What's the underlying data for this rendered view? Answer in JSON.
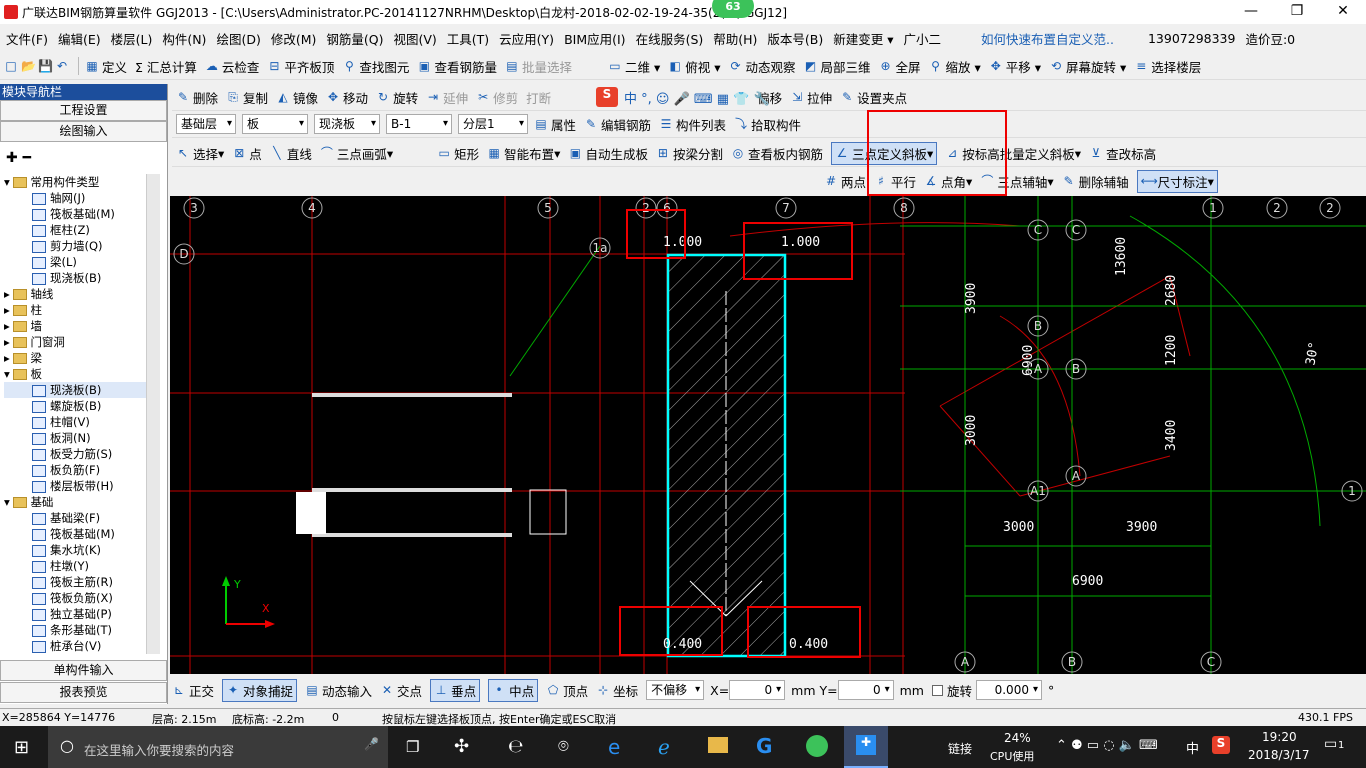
{
  "titlebar": {
    "title": "广联达BIM钢筋算量软件 GGJ2013 - [C:\\Users\\Administrator.PC-20141127NRHM\\Desktop\\白龙村-2018-02-02-19-24-35(2(...).GGJ12]",
    "badge": "63"
  },
  "menu": [
    "文件(F)",
    "编辑(E)",
    "楼层(L)",
    "构件(N)",
    "绘图(D)",
    "修改(M)",
    "钢筋量(Q)",
    "视图(V)",
    "工具(T)",
    "云应用(Y)",
    "BIM应用(I)",
    "在线服务(S)",
    "帮助(H)",
    "版本号(B)",
    "新建变更 ▾",
    "广小二",
    "如何快速布置自定义范..",
    "13907298339",
    "造价豆:0"
  ],
  "toolbar1": [
    "定义",
    "Σ 汇总计算",
    "云检查",
    "平齐板顶",
    "查找图元",
    "查看钢筋量",
    "批量选择",
    "二维 ▾",
    "俯视 ▾",
    "动态观察",
    "局部三维",
    "全屏",
    "缩放 ▾",
    "平移 ▾",
    "屏幕旋转 ▾",
    "选择楼层"
  ],
  "toolbar2": [
    "删除",
    "复制",
    "镜像",
    "移动",
    "旋转",
    "延伸",
    "修剪",
    "打断",
    "偏移",
    "拉伸",
    "设置夹点"
  ],
  "selectors": {
    "floor": "基础层",
    "category": "板",
    "type": "现浇板",
    "name": "B-1",
    "layer": "分层1"
  },
  "toolbar3": [
    "属性",
    "编辑钢筋",
    "构件列表",
    "拾取构件"
  ],
  "toolbar4": [
    "选择",
    "点",
    "直线",
    "三点画弧",
    "矩形",
    "智能布置",
    "自动生成板",
    "按梁分割",
    "查看板内钢筋",
    "三点定义斜板",
    "按标高批量定义斜板",
    "查改标高"
  ],
  "toolbar5": [
    "两点",
    "平行",
    "点角",
    "三点辅轴",
    "删除辅轴",
    "尺寸标注"
  ],
  "sidebar": {
    "title": "模块导航栏",
    "buttons": [
      "工程设置",
      "绘图输入"
    ],
    "tree": [
      "常用构件类型",
      "轴网(J)",
      "筏板基础(M)",
      "框柱(Z)",
      "剪力墙(Q)",
      "梁(L)",
      "现浇板(B)",
      "轴线",
      "柱",
      "墙",
      "门窗洞",
      "梁",
      "板",
      "现浇板(B)",
      "螺旋板(B)",
      "柱帽(V)",
      "板洞(N)",
      "板受力筋(S)",
      "板负筋(F)",
      "楼层板带(H)",
      "基础",
      "基础梁(F)",
      "筏板基础(M)",
      "集水坑(K)",
      "柱墩(Y)",
      "筏板主筋(R)",
      "筏板负筋(X)",
      "独立基础(P)",
      "条形基础(T)",
      "桩承台(V)"
    ],
    "bottom_buttons": [
      "单构件输入",
      "报表预览"
    ]
  },
  "canvas": {
    "axis_top": [
      "3",
      "4",
      "5",
      "2",
      "6",
      "7",
      "8",
      "1",
      "2",
      "2"
    ],
    "elev_labels": [
      "1.000",
      "1.000",
      "0.400",
      "0.400"
    ],
    "dims": [
      "3900",
      "3000",
      "13600",
      "2680",
      "1200",
      "3400",
      "3000",
      "3900",
      "6900",
      "6900",
      "30°"
    ],
    "axis_letters": [
      "D",
      "C",
      "C",
      "B",
      "A",
      "B",
      "A1",
      "A",
      "A",
      "B",
      "C",
      "1a",
      "1"
    ]
  },
  "snapbar": {
    "items": [
      "正交",
      "对象捕捉",
      "动态输入",
      "交点",
      "垂点",
      "中点",
      "顶点",
      "坐标"
    ],
    "offset": "不偏移",
    "x_label": "X=",
    "x_val": "0",
    "y_label": "Y=",
    "y_val": "0",
    "unit": "mm",
    "rotate_label": "旋转",
    "rotate_val": "0.000",
    "deg": "°"
  },
  "status": {
    "coords": "X=285864 Y=14776",
    "floor_height": "层高: 2.15m",
    "base_height": "底标高: -2.2m",
    "zero": "0",
    "hint": "按鼠标左键选择板顶点, 按Enter确定或ESC取消",
    "fps": "430.1 FPS"
  },
  "taskbar": {
    "search": "在这里输入你要搜索的内容",
    "link": "链接",
    "cpu_pct": "24%",
    "cpu_label": "CPU使用",
    "ime": "中",
    "time": "19:20",
    "date": "2018/3/17",
    "notif": "1"
  }
}
